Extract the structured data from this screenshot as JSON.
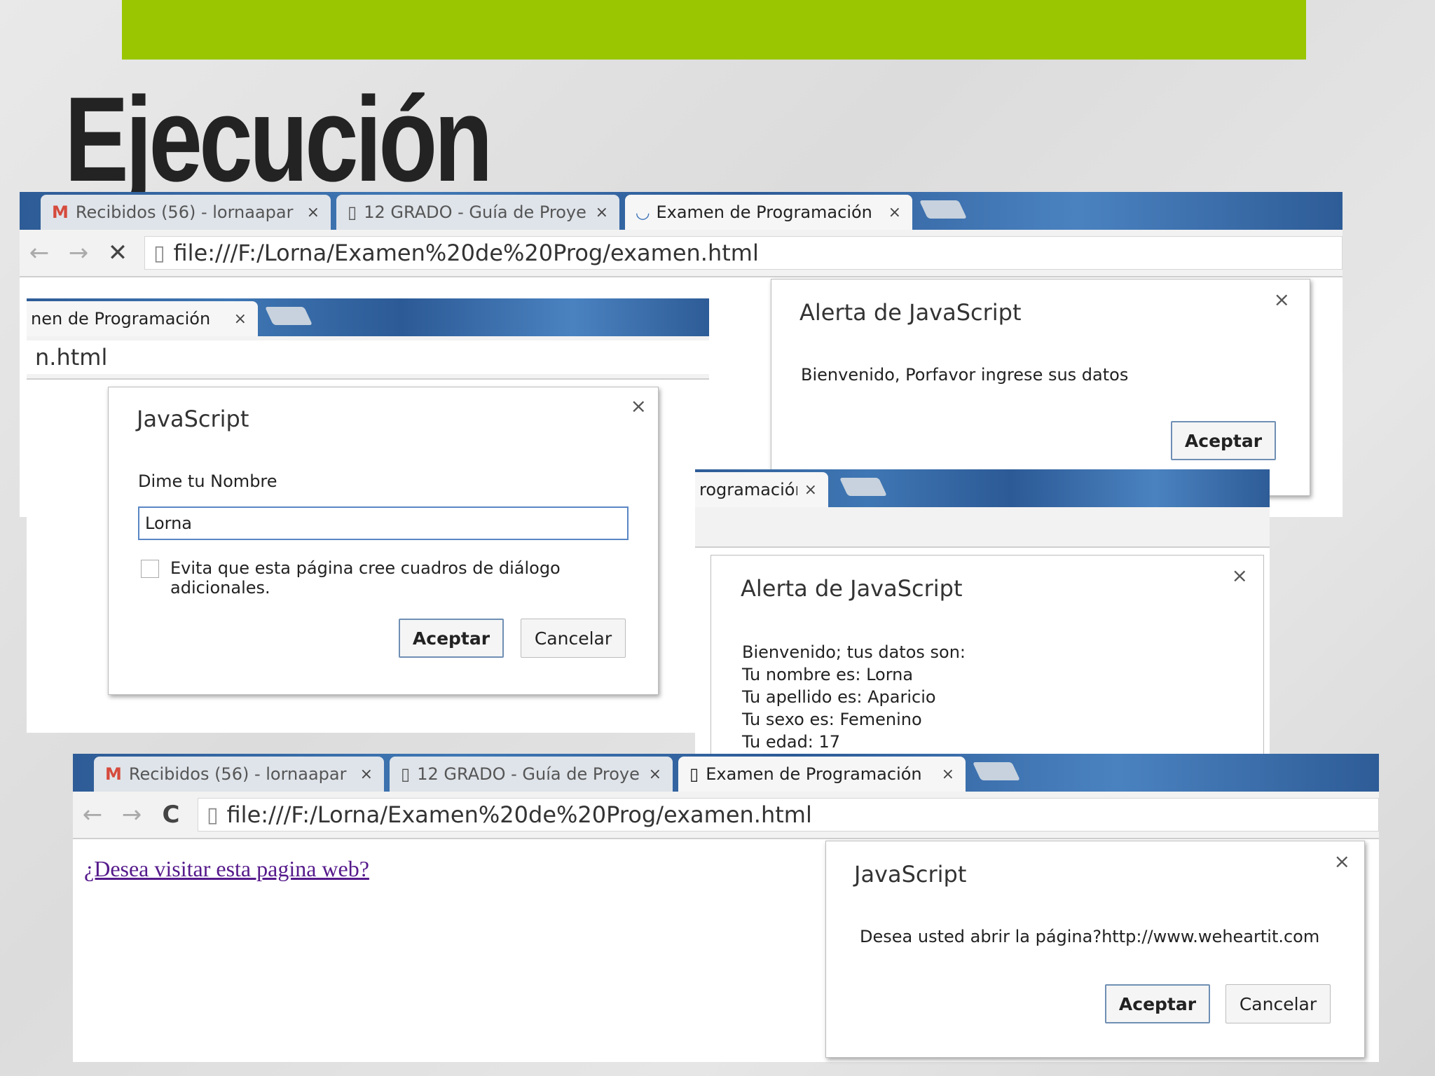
{
  "slide": {
    "title": "Ejecución",
    "accent_color": "#99c600"
  },
  "tabs": {
    "gmail": "Recibidos (56) - lornaapar",
    "guia": "12 GRADO - Guía de Proye",
    "examen": "Examen de Programación",
    "examen_cut1": "nen de Programación",
    "examen_cut2": "rogramación",
    "close_glyph": "×"
  },
  "toolbar": {
    "back_glyph": "←",
    "forward_glyph": "→",
    "stop_glyph": "✕",
    "reload_glyph": "C",
    "url": "file:///F:/Lorna/Examen%20de%20Prog/examen.html",
    "url_cut": "n.html"
  },
  "alert1": {
    "title": "Alerta de JavaScript",
    "message": "Bienvenido, Porfavor ingrese sus datos",
    "ok": "Aceptar"
  },
  "prompt": {
    "title": "JavaScript",
    "message": "Dime tu Nombre",
    "value": "Lorna",
    "checkbox_label": "Evita que esta página cree cuadros de diálogo adicionales.",
    "ok": "Aceptar",
    "cancel": "Cancelar"
  },
  "alert2": {
    "title": "Alerta de JavaScript",
    "lines": [
      "Bienvenido; tus datos son:",
      "Tu nombre es: Lorna",
      "Tu apellido es: Aparicio",
      "Tu sexo es: Femenino",
      "Tu edad: 17"
    ]
  },
  "page": {
    "link": "¿Desea visitar esta pagina web?"
  },
  "confirm": {
    "title": "JavaScript",
    "message": "Desea usted abrir la página?http://www.weheartit.com",
    "ok": "Aceptar",
    "cancel": "Cancelar"
  },
  "icons": {
    "gmail": "gmail-icon",
    "doc": "page-icon",
    "loading": "loading-spinner-icon"
  }
}
